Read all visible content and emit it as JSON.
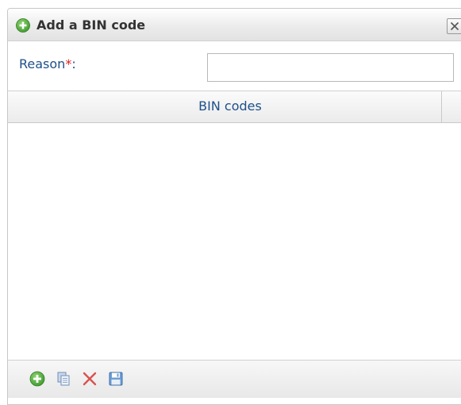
{
  "dialog": {
    "title": "Add a BIN code",
    "title_icon": "add-circle-icon",
    "close_icon": "close-icon"
  },
  "form": {
    "reason_label": "Reason",
    "required_mark": "*",
    "label_suffix": ":",
    "reason_value": ""
  },
  "grid": {
    "columns": [
      "BIN codes"
    ],
    "rows": []
  },
  "toolbar": {
    "buttons": [
      {
        "icon": "add-circle-icon",
        "color": "#4aa33a"
      },
      {
        "icon": "copy-icon",
        "color": "#6f8fb8"
      },
      {
        "icon": "delete-icon",
        "color": "#d9534f"
      },
      {
        "icon": "save-icon",
        "color": "#4a86c5"
      }
    ]
  },
  "colors": {
    "label": "#1e4f8a",
    "required": "#e02020",
    "add_green": "#4aa33a"
  }
}
